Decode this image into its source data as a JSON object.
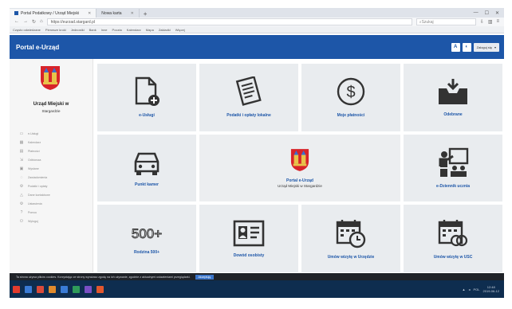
{
  "browser": {
    "tabs": [
      {
        "label": "Portal Podatkowy / Urząd Miejski"
      },
      {
        "label": "Nowa karta"
      }
    ],
    "new_tab": "+",
    "url": "https://eurzad.stargard.pl",
    "search_placeholder": "Szukaj",
    "bookmarks": [
      "Często odwiedzane",
      "Pierwsze kroki",
      "Jednostki",
      "Bank",
      "Inne",
      "Poczta",
      "Kalendarz",
      "Mapa",
      "Zakładki",
      "Więcej"
    ]
  },
  "app": {
    "brand": "Portal e-Urząd",
    "header_buttons": [
      "A",
      "◐"
    ],
    "account_label": "Zaloguj się"
  },
  "sidebar": {
    "org_name": "Urząd Miejski w",
    "org_city": "Stargardzie",
    "items": [
      {
        "label": "e-Usługi",
        "icon": "file-icon"
      },
      {
        "label": "Kalendarz",
        "icon": "calendar-icon"
      },
      {
        "label": "Płatności",
        "icon": "payment-icon"
      },
      {
        "label": "Odbiorcza",
        "icon": "inbox-icon"
      },
      {
        "label": "Wysłane",
        "icon": "outbox-icon"
      },
      {
        "label": "Zawiadomienia",
        "icon": "bell-icon"
      },
      {
        "label": "Podatki i opłaty",
        "icon": "tax-icon"
      },
      {
        "label": "Dane kontaktowe",
        "icon": "contact-icon"
      },
      {
        "label": "Ustawienia",
        "icon": "settings-icon"
      },
      {
        "label": "Pomoc",
        "icon": "help-icon"
      },
      {
        "label": "Wyloguj",
        "icon": "logout-icon"
      }
    ]
  },
  "tiles": [
    {
      "label": "e-Usługi",
      "icon": "new-document-icon"
    },
    {
      "label": "Podatki i opłaty lokalne",
      "icon": "tax-form-icon"
    },
    {
      "label": "Moje płatności",
      "icon": "dollar-coin-icon"
    },
    {
      "label": "Odebrane",
      "icon": "inbox-tray-icon"
    },
    {
      "label": "Punkt kamer",
      "icon": "car-icon"
    },
    {
      "label": "Portal e-Urząd",
      "sublabel": "Urząd Miejski w Stargardzie",
      "icon": "city-crest-icon"
    },
    {
      "label": "e-Dziennik ucznia",
      "icon": "classroom-icon"
    },
    {
      "label": "Rodzina 500+",
      "icon": "500-plus-icon",
      "badge": "500+"
    },
    {
      "label": "Dowód osobisty",
      "icon": "id-card-icon"
    },
    {
      "label": "Umów wizytę w Urzędzie",
      "icon": "calendar-clock-icon"
    },
    {
      "label": "Umów wizytę w USC",
      "icon": "calendar-rings-icon"
    }
  ],
  "cookie_bar": {
    "text": "Ta strona używa plików cookies. Korzystając ze strony wyrażasz zgodę na ich używanie, zgodnie z aktualnymi ustawieniami przeglądarki.",
    "button": "Akceptuję"
  },
  "taskbar": {
    "time": "12:48",
    "date": "2019-06-12",
    "lang": "POL"
  },
  "colors": {
    "brand_blue": "#1d56a8",
    "tile_bg": "#e9ecef",
    "taskbar": "#0e2d4f"
  }
}
